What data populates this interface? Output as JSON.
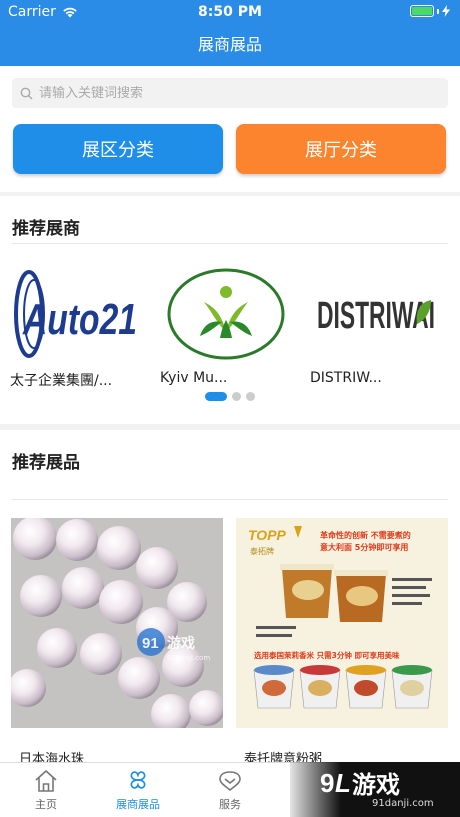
{
  "status_bar": {
    "carrier": "Carrier",
    "time": "8:50 PM"
  },
  "nav": {
    "title": "展商展品"
  },
  "search": {
    "placeholder": "请输入关键词搜索"
  },
  "category_buttons": {
    "zone": "展区分类",
    "hall": "展厅分类"
  },
  "recommended_exhibitors": {
    "title": "推荐展商",
    "items": [
      {
        "name": "太子企業集團/...",
        "logo_text": "Auto21"
      },
      {
        "name": "Kyiv Mu..."
      },
      {
        "name": "DISTRIW...",
        "logo_text": "DISTRIWAI"
      }
    ],
    "page_count": 3,
    "active_page": 1
  },
  "recommended_products": {
    "title": "推荐展品",
    "items": [
      {
        "name": "日本海水珠",
        "watermark": {
          "brand": "游戏",
          "url": "91danji.com"
        }
      },
      {
        "name": "泰托牌意粉粥",
        "poster": {
          "brand": "TOPP",
          "brand_cn": "泰拓牌",
          "headline_1": "革命性的创新 不需要煮的",
          "headline_2": "意大利面 5分钟即可享用",
          "slogan": "选用泰国茉莉香米 只需3分钟 即可享用美味"
        }
      }
    ]
  },
  "tab_bar": {
    "items": [
      {
        "label": "主页",
        "icon": "home-icon"
      },
      {
        "label": "展商展品",
        "icon": "clover-icon"
      },
      {
        "label": "服务",
        "icon": "heart-chat-icon"
      }
    ]
  },
  "watermark": {
    "brand": "游戏",
    "url": "91danji.com"
  },
  "colors": {
    "primary": "#2b8ce8",
    "accent_orange": "#fc842e",
    "active_tab": "#1f8ee9"
  }
}
